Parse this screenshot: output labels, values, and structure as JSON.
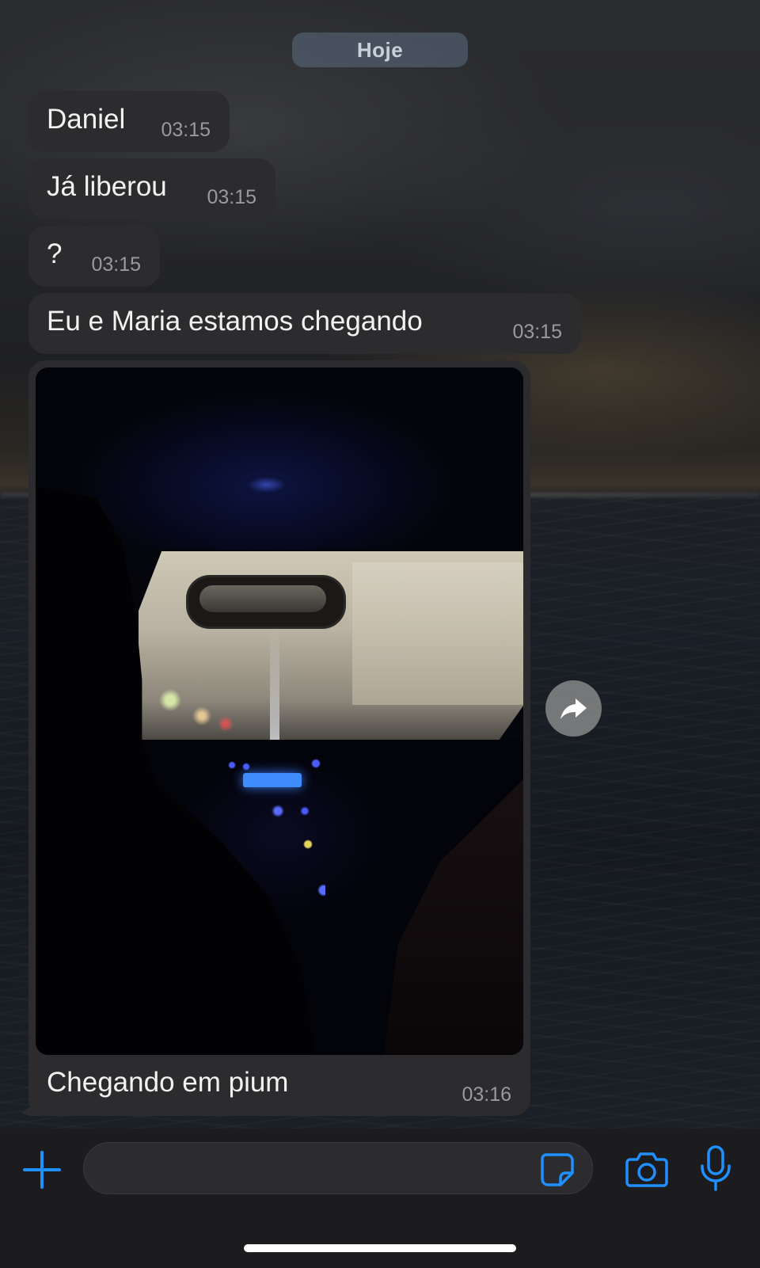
{
  "date_separator": "Hoje",
  "messages": [
    {
      "text": "Daniel",
      "time": "03:15"
    },
    {
      "text": "Já liberou",
      "time": "03:15"
    },
    {
      "text": "?",
      "time": "03:15"
    },
    {
      "text": "Eu e Maria estamos chegando",
      "time": "03:15"
    }
  ],
  "photo_message": {
    "caption": "Chegando em pium",
    "time": "03:16"
  },
  "composer": {
    "placeholder": "",
    "value": ""
  },
  "icons": {
    "attach": "plus-icon",
    "sticker": "sticker-icon",
    "camera": "camera-icon",
    "microphone": "microphone-icon",
    "forward": "share-arrow-icon"
  },
  "colors": {
    "accent": "#1e90ff",
    "bubble_incoming": "#2c2c2e",
    "timestamp": "#9a9a9e",
    "date_chip": "#5c6e82"
  }
}
